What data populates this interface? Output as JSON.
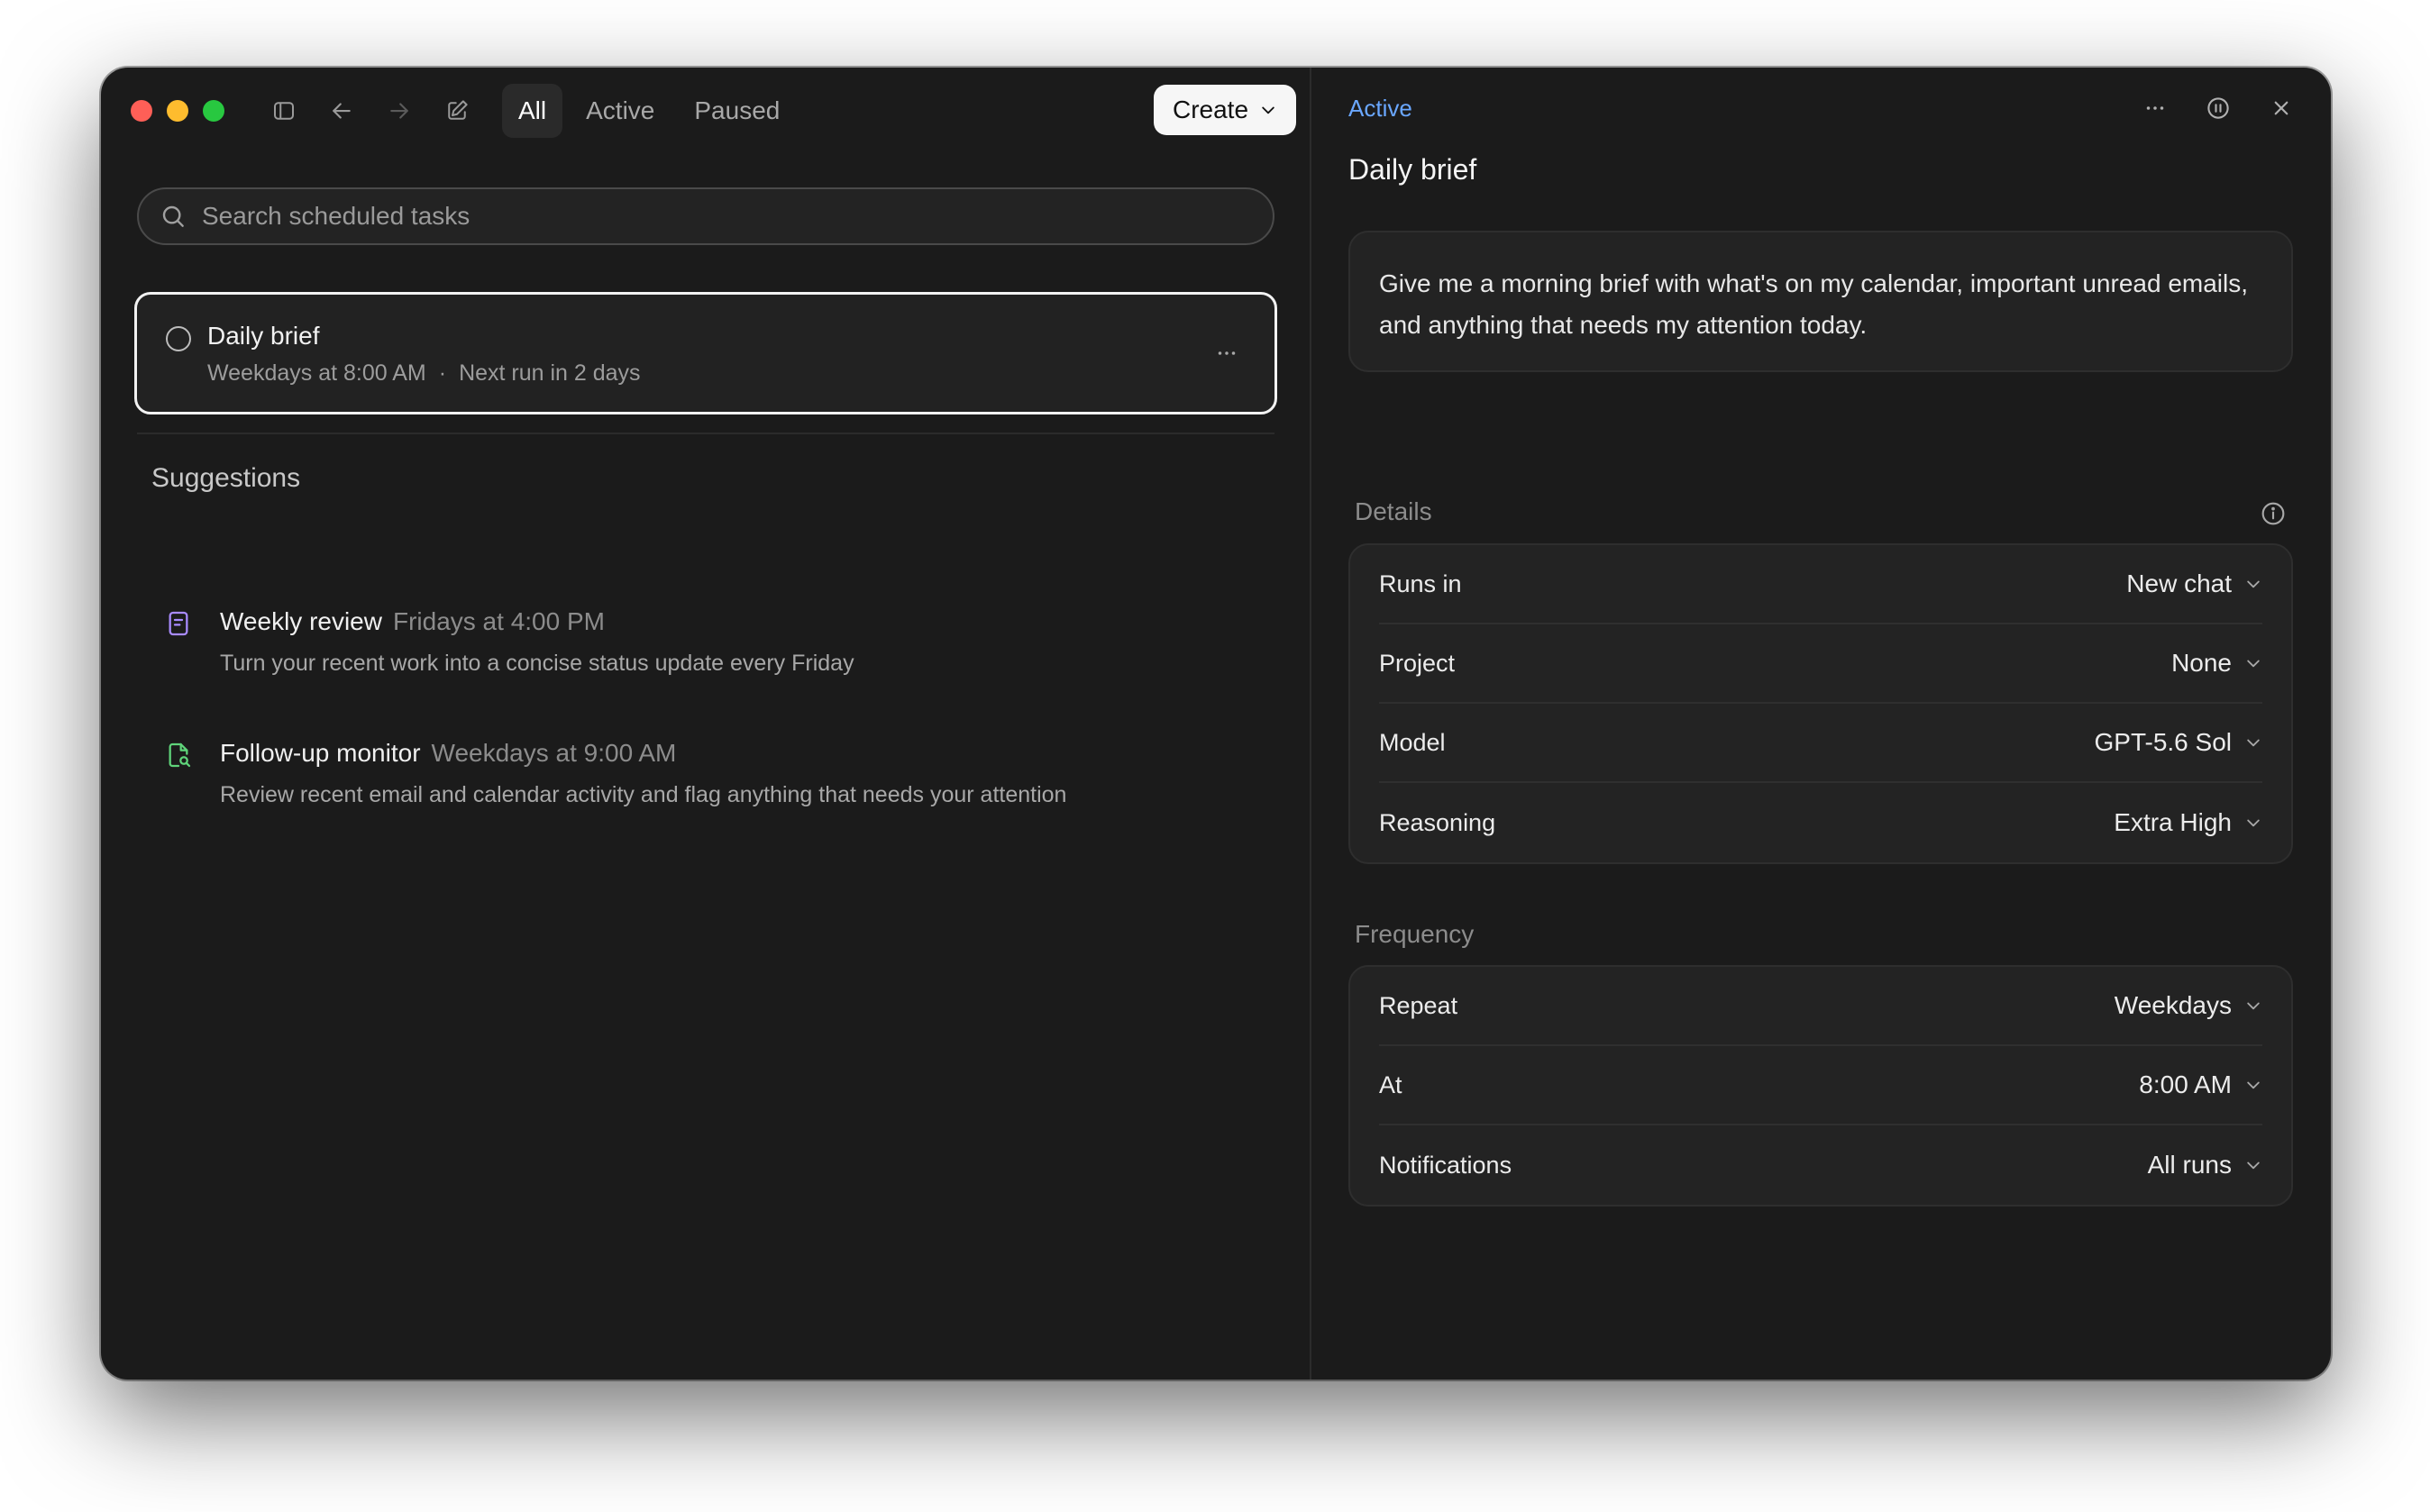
{
  "toolbar": {
    "tabs": [
      {
        "label": "All",
        "active": true
      },
      {
        "label": "Active",
        "active": false
      },
      {
        "label": "Paused",
        "active": false
      }
    ],
    "create_label": "Create"
  },
  "search": {
    "placeholder": "Search scheduled tasks"
  },
  "task": {
    "title": "Daily brief",
    "schedule": "Weekdays at 8:00 AM",
    "separator": "·",
    "next_run": "Next run in 2 days"
  },
  "suggestions": {
    "heading": "Suggestions",
    "items": [
      {
        "title": "Weekly review",
        "when": "Fridays at 4:00 PM",
        "description": "Turn your recent work into a concise status update every Friday",
        "icon": "notebook-icon",
        "icon_color": "#a98bff"
      },
      {
        "title": "Follow-up monitor",
        "when": "Weekdays at 9:00 AM",
        "description": "Review recent email and calendar activity and flag anything that needs your attention",
        "icon": "document-search-icon",
        "icon_color": "#5fd47a"
      }
    ]
  },
  "detail": {
    "status": "Active",
    "status_color": "#6aa7ff",
    "title": "Daily brief",
    "prompt": "Give me a morning brief with what's on my calendar, important unread emails, and anything that needs my attention today.",
    "details_label": "Details",
    "details": [
      {
        "label": "Runs in",
        "value": "New chat"
      },
      {
        "label": "Project",
        "value": "None"
      },
      {
        "label": "Model",
        "value": "GPT-5.6 Sol"
      },
      {
        "label": "Reasoning",
        "value": "Extra High"
      }
    ],
    "frequency_label": "Frequency",
    "frequency": [
      {
        "label": "Repeat",
        "value": "Weekdays"
      },
      {
        "label": "At",
        "value": "8:00 AM"
      },
      {
        "label": "Notifications",
        "value": "All runs"
      }
    ]
  }
}
